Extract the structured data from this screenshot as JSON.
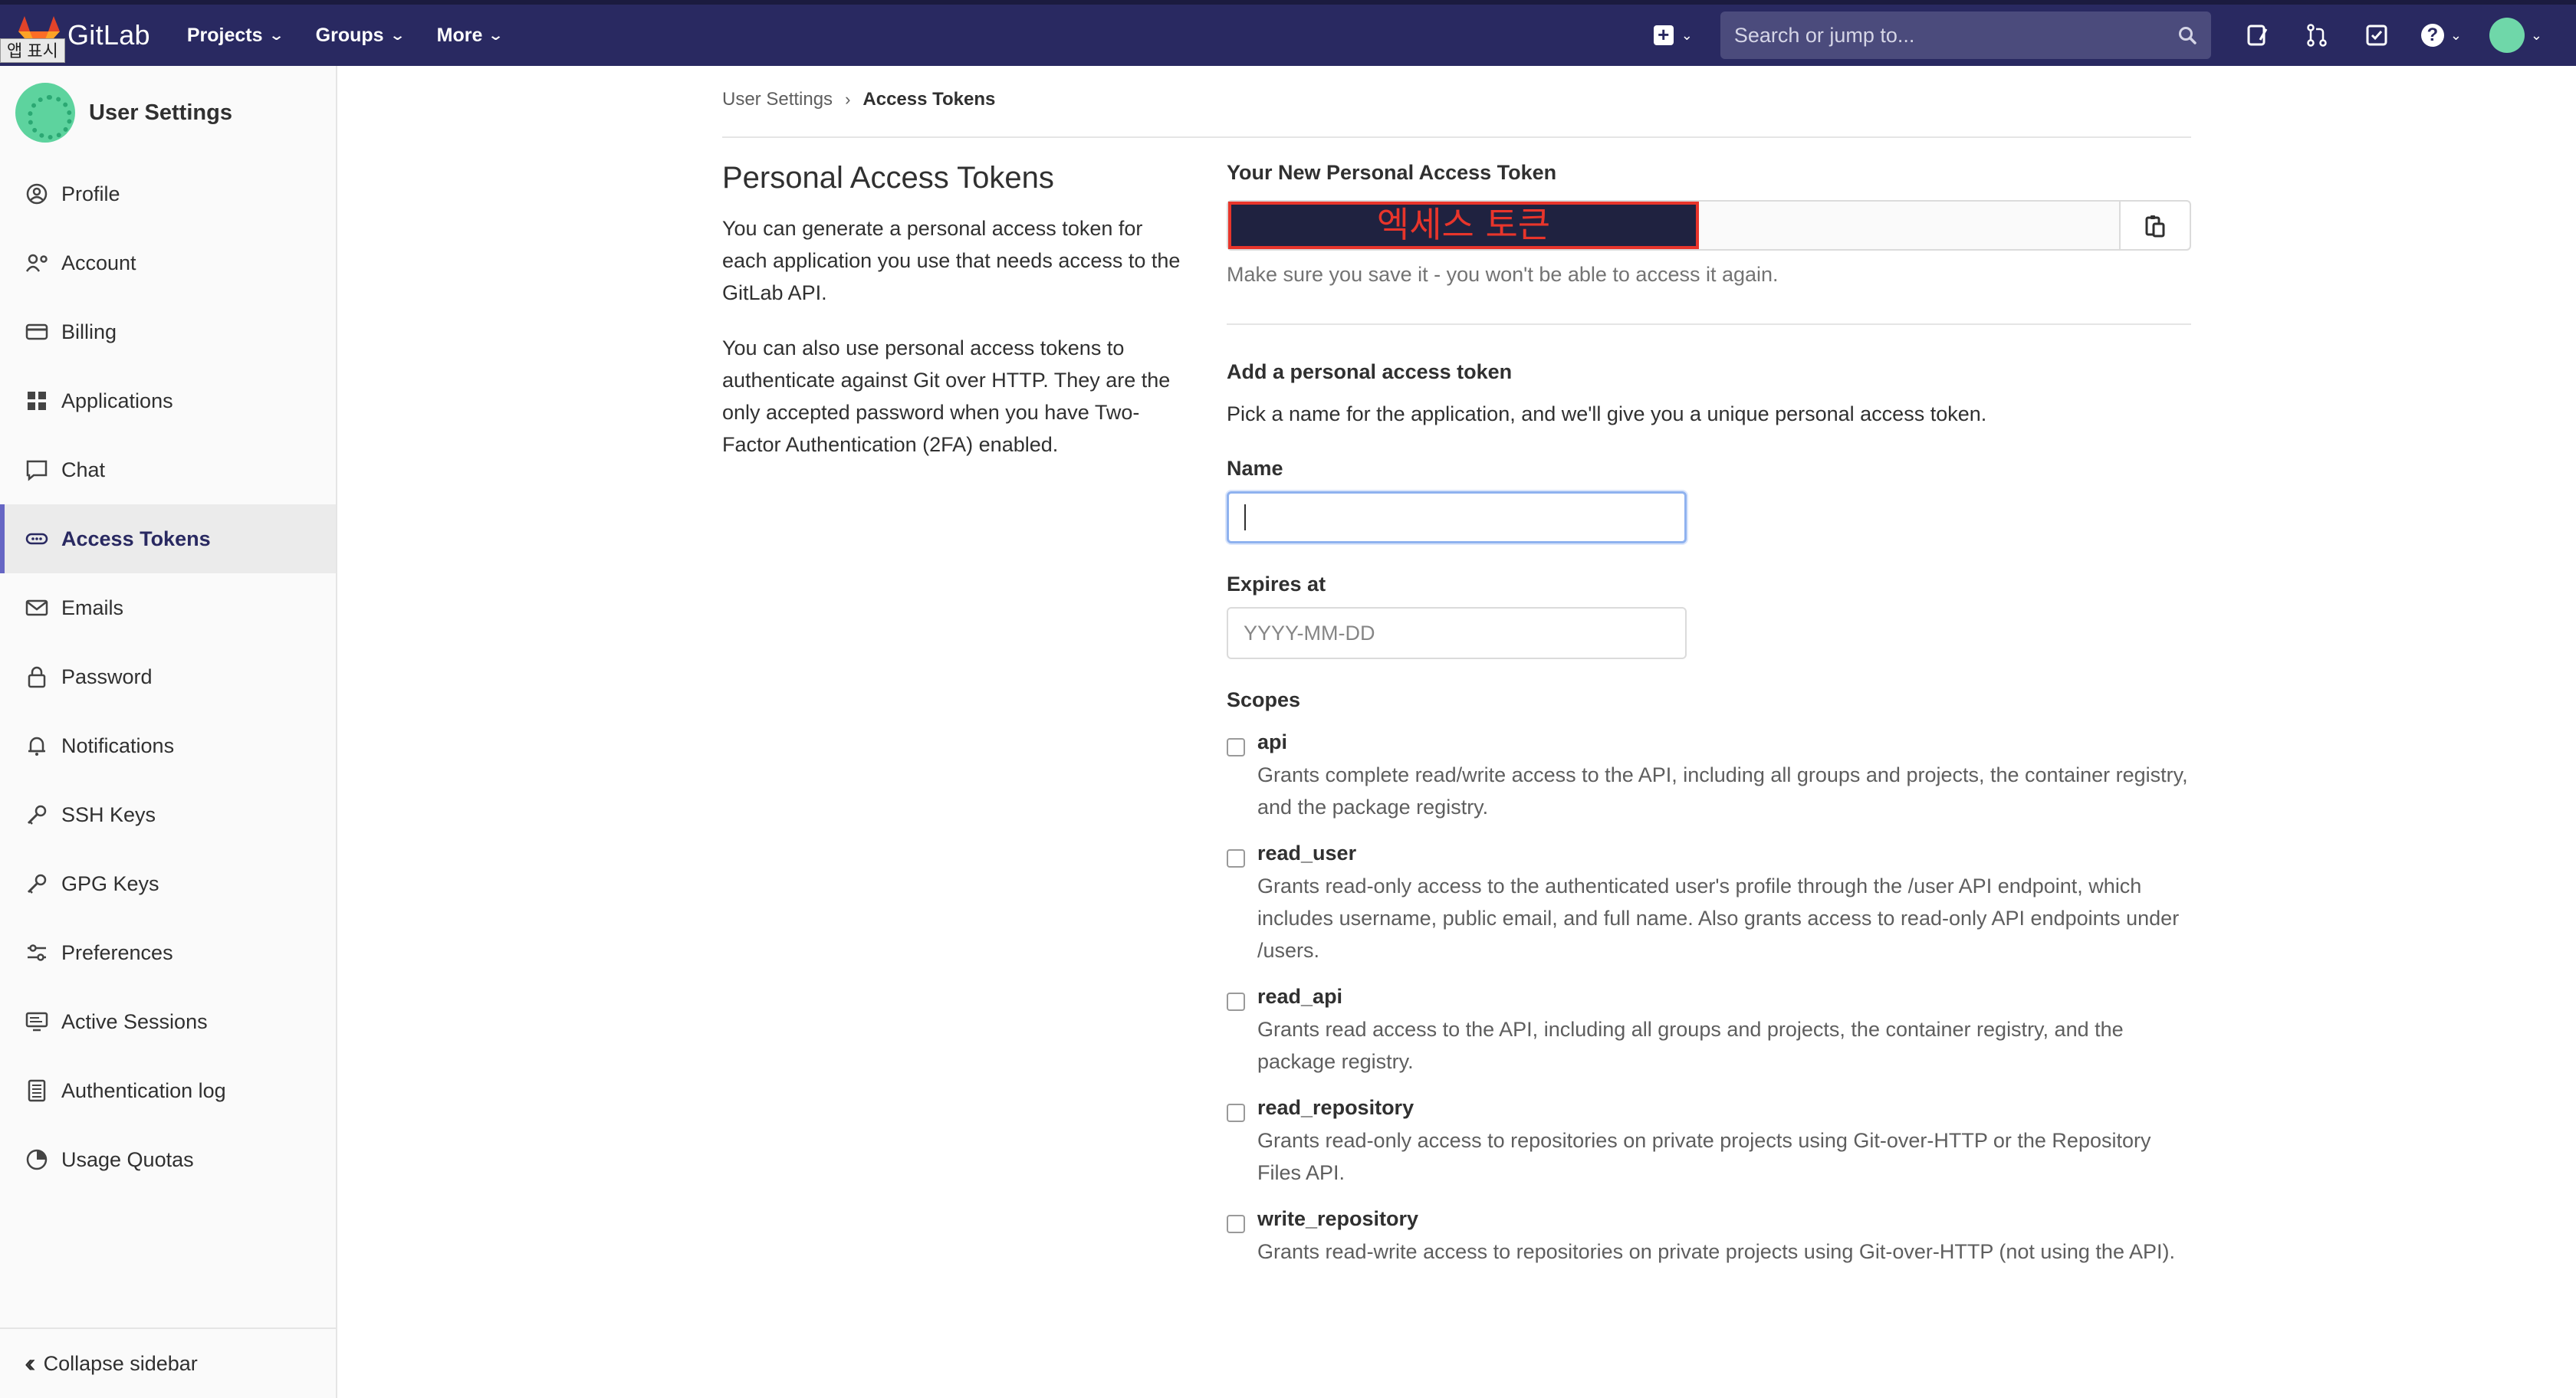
{
  "app": {
    "name": "GitLab",
    "overlay_tag": "앱 표시"
  },
  "topnav": {
    "items": [
      "Projects",
      "Groups",
      "More"
    ],
    "search_placeholder": "Search or jump to..."
  },
  "sidebar": {
    "title": "User Settings",
    "items": [
      {
        "label": "Profile",
        "icon": "profile-icon"
      },
      {
        "label": "Account",
        "icon": "account-icon"
      },
      {
        "label": "Billing",
        "icon": "credit-card-icon"
      },
      {
        "label": "Applications",
        "icon": "applications-grid-icon"
      },
      {
        "label": "Chat",
        "icon": "chat-icon"
      },
      {
        "label": "Access Tokens",
        "icon": "token-icon",
        "active": true
      },
      {
        "label": "Emails",
        "icon": "mail-icon"
      },
      {
        "label": "Password",
        "icon": "lock-icon"
      },
      {
        "label": "Notifications",
        "icon": "bell-icon"
      },
      {
        "label": "SSH Keys",
        "icon": "key-icon"
      },
      {
        "label": "GPG Keys",
        "icon": "key-icon"
      },
      {
        "label": "Preferences",
        "icon": "preferences-icon"
      },
      {
        "label": "Active Sessions",
        "icon": "monitor-icon"
      },
      {
        "label": "Authentication log",
        "icon": "log-icon"
      },
      {
        "label": "Usage Quotas",
        "icon": "quota-icon"
      }
    ],
    "collapse_label": "Collapse sidebar"
  },
  "breadcrumb": {
    "parent": "User Settings",
    "current": "Access Tokens"
  },
  "intro": {
    "title": "Personal Access Tokens",
    "p1": "You can generate a personal access token for each application you use that needs access to the GitLab API.",
    "p2": "You can also use personal access tokens to authenticate against Git over HTTP. They are the only accepted password when you have Two-Factor Authentication (2FA) enabled."
  },
  "new_token": {
    "label": "Your New Personal Access Token",
    "value_redacted": "엑세스 토큰",
    "hint": "Make sure you save it - you won't be able to access it again."
  },
  "form": {
    "title": "Add a personal access token",
    "desc": "Pick a name for the application, and we'll give you a unique personal access token.",
    "name_label": "Name",
    "name_value": "",
    "expires_label": "Expires at",
    "expires_placeholder": "YYYY-MM-DD",
    "scopes_label": "Scopes",
    "scopes": [
      {
        "name": "api",
        "desc": "Grants complete read/write access to the API, including all groups and projects, the container registry, and the package registry.",
        "checked": false
      },
      {
        "name": "read_user",
        "desc": "Grants read-only access to the authenticated user's profile through the /user API endpoint, which includes username, public email, and full name. Also grants access to read-only API endpoints under /users.",
        "checked": false
      },
      {
        "name": "read_api",
        "desc": "Grants read access to the API, including all groups and projects, the container registry, and the package registry.",
        "checked": false
      },
      {
        "name": "read_repository",
        "desc": "Grants read-only access to repositories on private projects using Git-over-HTTP or the Repository Files API.",
        "checked": false
      },
      {
        "name": "write_repository",
        "desc": "Grants read-write access to repositories on private projects using Git-over-HTTP (not using the API).",
        "checked": false
      }
    ]
  },
  "colors": {
    "navbar": "#292961",
    "active_accent": "#6666c4",
    "redaction_border": "#e8352b"
  }
}
